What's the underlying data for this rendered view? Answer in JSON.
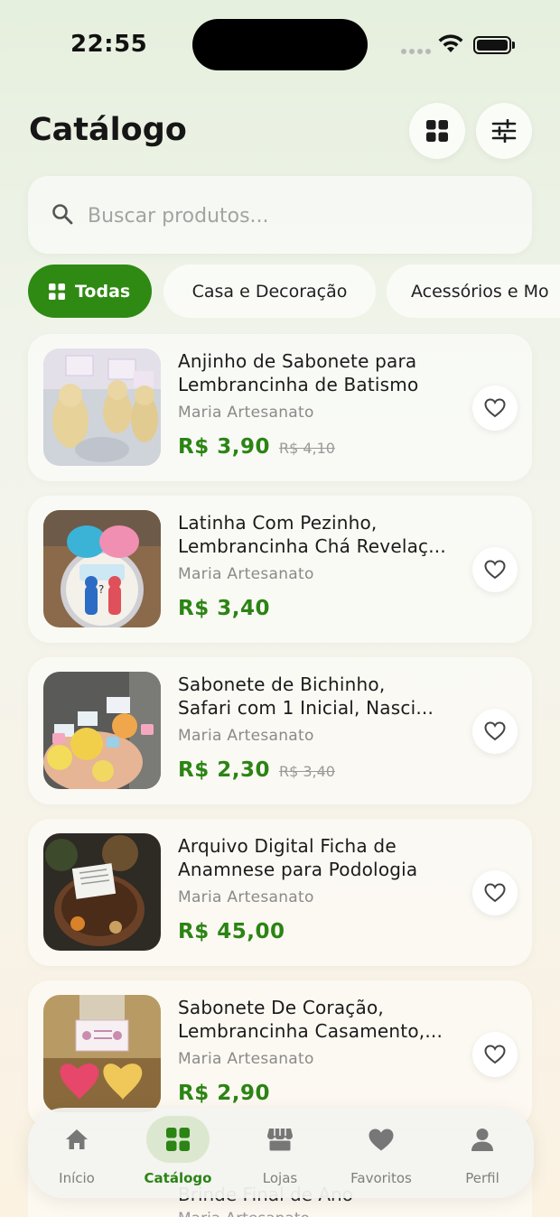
{
  "status_bar": {
    "time": "22:55"
  },
  "header": {
    "title": "Catálogo"
  },
  "search": {
    "placeholder": "Buscar produtos..."
  },
  "categories": [
    {
      "label": "Todas",
      "active": true
    },
    {
      "label": "Casa e Decoração",
      "active": false
    },
    {
      "label": "Acessórios e Mo",
      "active": false
    }
  ],
  "products": [
    {
      "name_line1": "Anjinho de Sabonete para",
      "name_line2": "Lembrancinha de Batismo",
      "seller": "Maria Artesanato",
      "price": "R$ 3,90",
      "old_price": "R$ 4,10"
    },
    {
      "name_line1": "Latinha Com Pezinho,",
      "name_line2": "Lembrancinha Chá Revelaç...",
      "seller": "Maria Artesanato",
      "price": "R$ 3,40",
      "old_price": ""
    },
    {
      "name_line1": "Sabonete de Bichinho,",
      "name_line2": "Safari com 1 Inicial, Nasci...",
      "seller": "Maria Artesanato",
      "price": "R$ 2,30",
      "old_price": "R$ 3,40"
    },
    {
      "name_line1": "Arquivo Digital Ficha de",
      "name_line2": "Anamnese para Podologia",
      "seller": "Maria Artesanato",
      "price": "R$ 45,00",
      "old_price": ""
    },
    {
      "name_line1": "Sabonete De Coração,",
      "name_line2": "Lembrancinha Casamento,...",
      "seller": "Maria Artesanato",
      "price": "R$ 2,90",
      "old_price": ""
    }
  ],
  "peek_product": {
    "name": "Brinde Final de Ano",
    "seller": "Maria Artesanato"
  },
  "bottom_nav": [
    {
      "label": "Início",
      "icon": "home-icon",
      "active": false
    },
    {
      "label": "Catálogo",
      "icon": "grid-icon",
      "active": true
    },
    {
      "label": "Lojas",
      "icon": "store-icon",
      "active": false
    },
    {
      "label": "Favoritos",
      "icon": "heart-icon",
      "active": false
    },
    {
      "label": "Perfil",
      "icon": "person-icon",
      "active": false
    }
  ],
  "colors": {
    "accent": "#2e8a12",
    "price": "#2b8414"
  }
}
